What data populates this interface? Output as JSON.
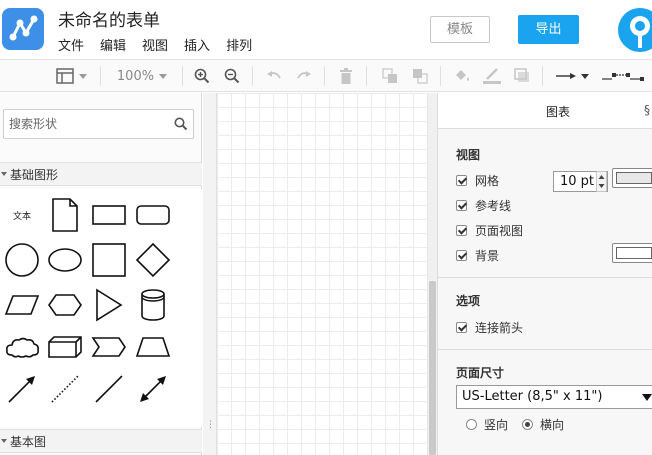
{
  "header": {
    "doc_title": "未命名的表单",
    "menu": [
      "文件",
      "编辑",
      "视图",
      "插入",
      "排列"
    ],
    "template_button": "模板",
    "export_button": "导出",
    "brand_color": "#1aa3ee"
  },
  "toolbar": {
    "zoom": "100%",
    "icons": [
      "layout-panel-icon",
      "zoom-in-icon",
      "zoom-out-icon",
      "undo-icon",
      "redo-icon",
      "delete-icon",
      "to-front-icon",
      "to-back-icon",
      "fill-color-icon",
      "line-color-icon",
      "shadow-icon",
      "connector-arrow-icon",
      "waypoints-icon"
    ]
  },
  "left_panel": {
    "search_placeholder": "搜索形状",
    "section_basic": "基础图形",
    "section_basic2": "基本图",
    "text_shape_label": "文本",
    "shapes": [
      "text",
      "document",
      "rectangle",
      "rounded-rectangle",
      "circle",
      "ellipse",
      "square",
      "diamond",
      "parallelogram",
      "hexagon",
      "triangle",
      "cylinder",
      "cloud",
      "cube",
      "step",
      "trapezoid",
      "arrow-line",
      "dotted-line",
      "line",
      "bidirectional-arrow"
    ]
  },
  "right_panel": {
    "tab": "图表",
    "view_title": "视图",
    "grid_label": "网格",
    "grid_checked": true,
    "grid_size": "10 pt",
    "guides_label": "参考线",
    "guides_checked": true,
    "page_view_label": "页面视图",
    "page_view_checked": true,
    "background_label": "背景",
    "background_checked": true,
    "options_title": "选项",
    "connection_arrows_label": "连接箭头",
    "connection_arrows_checked": true,
    "page_size_title": "页面尺寸",
    "page_size_value": "US-Letter (8,5\" x 11\")",
    "portrait_label": "竖向",
    "landscape_label": "横向",
    "orientation": "landscape"
  }
}
